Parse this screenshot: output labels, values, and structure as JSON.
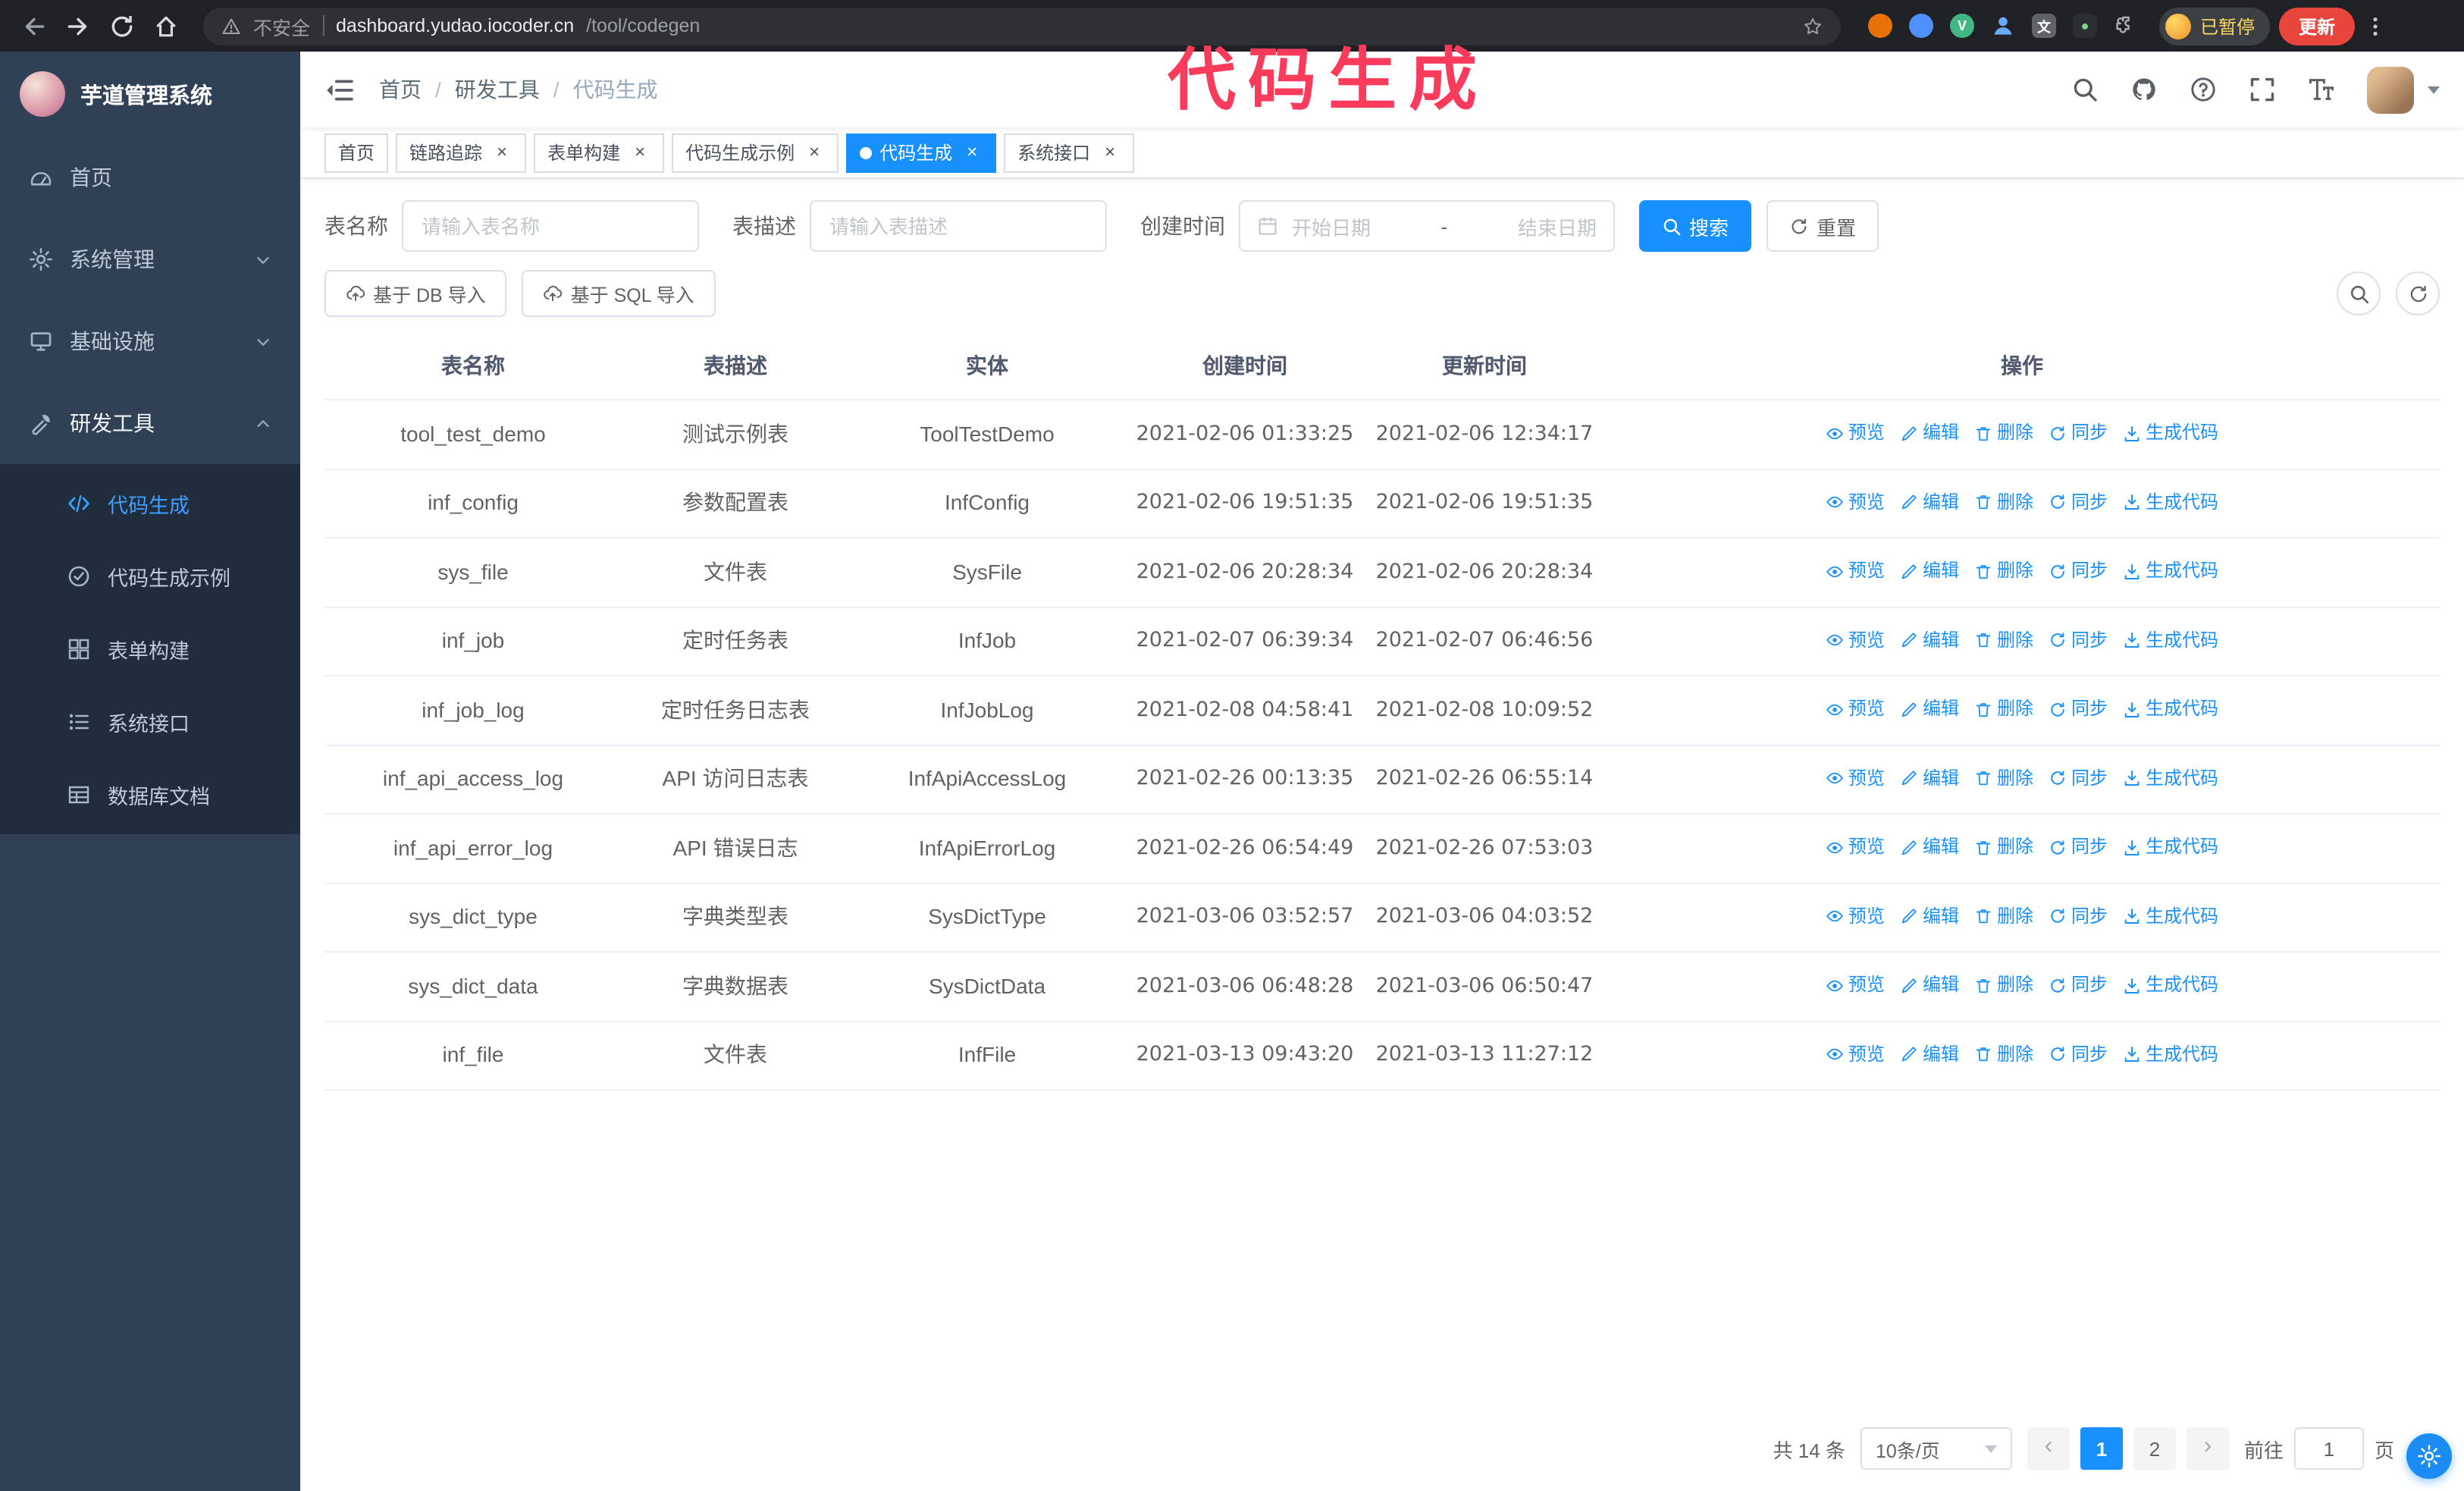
{
  "annotation": {
    "text": "代码生成"
  },
  "browser": {
    "security_label": "不安全",
    "url_host": "dashboard.yudao.iocoder.cn",
    "url_path": "/tool/codegen",
    "profile_badge": "已暂停",
    "update_label": "更新"
  },
  "sidebar": {
    "logo_title": "芋道管理系统",
    "items": [
      {
        "key": "home",
        "icon": "dashboard",
        "label": "首页"
      },
      {
        "key": "system",
        "icon": "gear",
        "label": "系统管理",
        "chevron": "down"
      },
      {
        "key": "infra",
        "icon": "infra",
        "label": "基础设施",
        "chevron": "down"
      },
      {
        "key": "dev-tools",
        "icon": "tool",
        "label": "研发工具",
        "chevron": "up",
        "expanded": true
      }
    ],
    "subitems": [
      {
        "key": "codegen",
        "icon": "code",
        "label": "代码生成",
        "active": true
      },
      {
        "key": "codegen-example",
        "icon": "example",
        "label": "代码生成示例"
      },
      {
        "key": "form-builder",
        "icon": "form",
        "label": "表单构建"
      },
      {
        "key": "system-api",
        "icon": "api",
        "label": "系统接口"
      },
      {
        "key": "db-doc",
        "icon": "db",
        "label": "数据库文档"
      }
    ]
  },
  "header": {
    "breadcrumb": [
      "首页",
      "研发工具",
      "代码生成"
    ]
  },
  "tags": [
    {
      "key": "home",
      "label": "首页",
      "closable": false
    },
    {
      "key": "tracing",
      "label": "链路追踪",
      "closable": true
    },
    {
      "key": "form-builder",
      "label": "表单构建",
      "closable": true
    },
    {
      "key": "codegen-example",
      "label": "代码生成示例",
      "closable": true
    },
    {
      "key": "codegen",
      "label": "代码生成",
      "closable": true,
      "active": true
    },
    {
      "key": "system-api",
      "label": "系统接口",
      "closable": true
    }
  ],
  "filters": {
    "table_name_label": "表名称",
    "table_name_placeholder": "请输入表名称",
    "table_desc_label": "表描述",
    "table_desc_placeholder": "请输入表描述",
    "create_time_label": "创建时间",
    "date_start_placeholder": "开始日期",
    "date_separator": "-",
    "date_end_placeholder": "结束日期",
    "search_label": "搜索",
    "reset_label": "重置"
  },
  "toolbar": {
    "import_db_label": "基于 DB 导入",
    "import_sql_label": "基于 SQL 导入"
  },
  "table": {
    "columns": [
      "表名称",
      "表描述",
      "实体",
      "创建时间",
      "更新时间",
      "操作"
    ],
    "actions": [
      "预览",
      "编辑",
      "删除",
      "同步",
      "生成代码"
    ],
    "rows": [
      {
        "name": "tool_test_demo",
        "desc": "测试示例表",
        "entity": "ToolTestDemo",
        "created": "2021-02-06 01:33:25",
        "updated": "2021-02-06 12:34:17"
      },
      {
        "name": "inf_config",
        "desc": "参数配置表",
        "entity": "InfConfig",
        "created": "2021-02-06 19:51:35",
        "updated": "2021-02-06 19:51:35"
      },
      {
        "name": "sys_file",
        "desc": "文件表",
        "entity": "SysFile",
        "created": "2021-02-06 20:28:34",
        "updated": "2021-02-06 20:28:34"
      },
      {
        "name": "inf_job",
        "desc": "定时任务表",
        "entity": "InfJob",
        "created": "2021-02-07 06:39:34",
        "updated": "2021-02-07 06:46:56"
      },
      {
        "name": "inf_job_log",
        "desc": "定时任务日志表",
        "entity": "InfJobLog",
        "created": "2021-02-08 04:58:41",
        "updated": "2021-02-08 10:09:52"
      },
      {
        "name": "inf_api_access_log",
        "desc": "API 访问日志表",
        "entity": "InfApiAccessLog",
        "created": "2021-02-26 00:13:35",
        "updated": "2021-02-26 06:55:14"
      },
      {
        "name": "inf_api_error_log",
        "desc": "API 错误日志",
        "entity": "InfApiErrorLog",
        "created": "2021-02-26 06:54:49",
        "updated": "2021-02-26 07:53:03"
      },
      {
        "name": "sys_dict_type",
        "desc": "字典类型表",
        "entity": "SysDictType",
        "created": "2021-03-06 03:52:57",
        "updated": "2021-03-06 04:03:52"
      },
      {
        "name": "sys_dict_data",
        "desc": "字典数据表",
        "entity": "SysDictData",
        "created": "2021-03-06 06:48:28",
        "updated": "2021-03-06 06:50:47"
      },
      {
        "name": "inf_file",
        "desc": "文件表",
        "entity": "InfFile",
        "created": "2021-03-13 09:43:20",
        "updated": "2021-03-13 11:27:12"
      }
    ]
  },
  "pagination": {
    "total_label": "共 14 条",
    "page_size_label": "10条/页",
    "pages": [
      "1",
      "2"
    ],
    "active_page": "1",
    "goto_label": "前往",
    "goto_value": "1",
    "goto_suffix": "页"
  }
}
